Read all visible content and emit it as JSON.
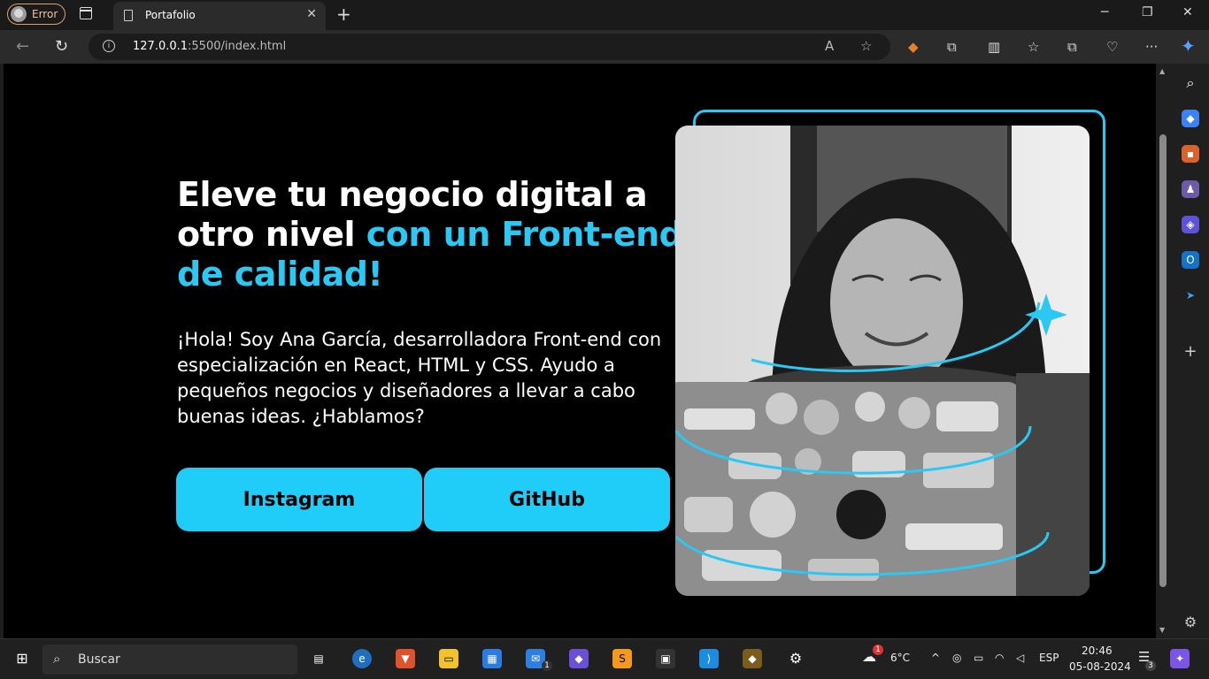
{
  "browser": {
    "profile_label": "Error",
    "tab_title": "Portafolio",
    "url_host": "127.0.0.1",
    "url_rest": ":5500/index.html"
  },
  "page": {
    "headline_white": "Eleve tu negocio digital a otro nivel",
    "headline_accent": "con un Front-end de calidad!",
    "intro": "¡Hola! Soy Ana García, desarrolladora Front-end con especialización en React, HTML y CSS. Ayudo a pequeños negocios y diseñadores a llevar a cabo buenas ideas. ¿Hablamos?",
    "buttons": [
      "Instagram",
      "GitHub"
    ],
    "accent_color": "#2ac8f2",
    "button_color": "#1fcdf8"
  },
  "taskbar": {
    "search_label": "Buscar",
    "weather": "6°C",
    "language": "ESP",
    "time": "20:46",
    "date": "05-08-2024",
    "notification_count": "3",
    "mail_badge": "1",
    "weather_badge": "1"
  }
}
